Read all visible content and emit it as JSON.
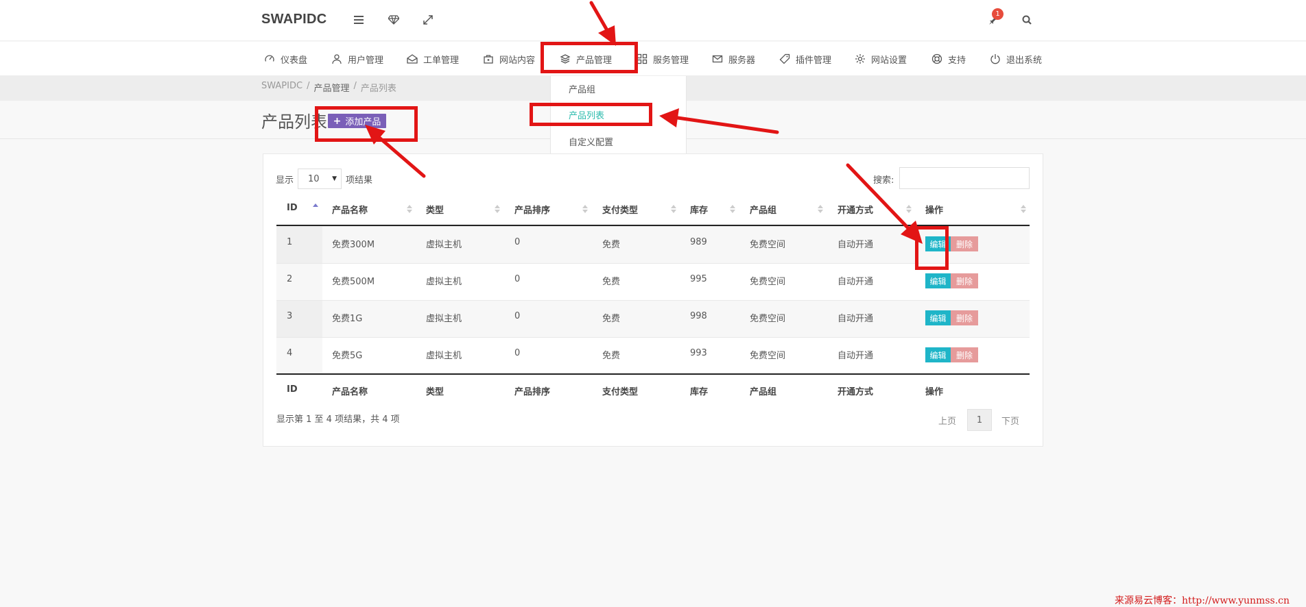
{
  "app": {
    "brand": "SWAPIDC",
    "notification_count": "1"
  },
  "nav": {
    "items": [
      {
        "label": "仪表盘",
        "icon": "speedometer-icon"
      },
      {
        "label": "用户管理",
        "icon": "user-icon"
      },
      {
        "label": "工单管理",
        "icon": "envelope-open-icon"
      },
      {
        "label": "网站内容",
        "icon": "bag-icon"
      },
      {
        "label": "产品管理",
        "icon": "layers-icon"
      },
      {
        "label": "服务管理",
        "icon": "grid-icon"
      },
      {
        "label": "服务器",
        "icon": "envelope-icon"
      },
      {
        "label": "插件管理",
        "icon": "tag-icon"
      },
      {
        "label": "网站设置",
        "icon": "gear-icon"
      },
      {
        "label": "支持",
        "icon": "lifebuoy-icon"
      },
      {
        "label": "退出系统",
        "icon": "power-icon"
      }
    ]
  },
  "dropdown": {
    "items": [
      "产品组",
      "产品列表",
      "自定义配置"
    ],
    "active": "产品列表"
  },
  "breadcrumb": {
    "home": "SWAPIDC",
    "sep": "/",
    "section": "产品管理",
    "current": "产品列表"
  },
  "page": {
    "title": "产品列表",
    "add_button": "添加产品"
  },
  "table": {
    "show_label": "显示",
    "page_size": "10",
    "results_label": "项结果",
    "search_label": "搜索:",
    "columns": [
      "ID",
      "产品名称",
      "类型",
      "产品排序",
      "支付类型",
      "库存",
      "产品组",
      "开通方式",
      "操作"
    ],
    "rows": [
      {
        "id": "1",
        "name": "免费300M",
        "type": "虚拟主机",
        "sort": "0",
        "pay": "免费",
        "stock": "989",
        "group": "免费空间",
        "open": "自动开通"
      },
      {
        "id": "2",
        "name": "免费500M",
        "type": "虚拟主机",
        "sort": "0",
        "pay": "免费",
        "stock": "995",
        "group": "免费空间",
        "open": "自动开通"
      },
      {
        "id": "3",
        "name": "免费1G",
        "type": "虚拟主机",
        "sort": "0",
        "pay": "免费",
        "stock": "998",
        "group": "免费空间",
        "open": "自动开通"
      },
      {
        "id": "4",
        "name": "免费5G",
        "type": "虚拟主机",
        "sort": "0",
        "pay": "免费",
        "stock": "993",
        "group": "免费空间",
        "open": "自动开通"
      }
    ],
    "edit_label": "编辑",
    "delete_label": "删除",
    "info": "显示第 1 至 4 项结果，共 4 项",
    "prev": "上页",
    "page": "1",
    "next": "下页"
  },
  "watermark": "来源易云博客：http://www.yunmss.cn",
  "colors": {
    "accent": "#7a5fb8",
    "edit": "#1fb5c8",
    "delete": "#e69b9b",
    "annotation": "#e21515",
    "active_link": "#2bbbad"
  }
}
